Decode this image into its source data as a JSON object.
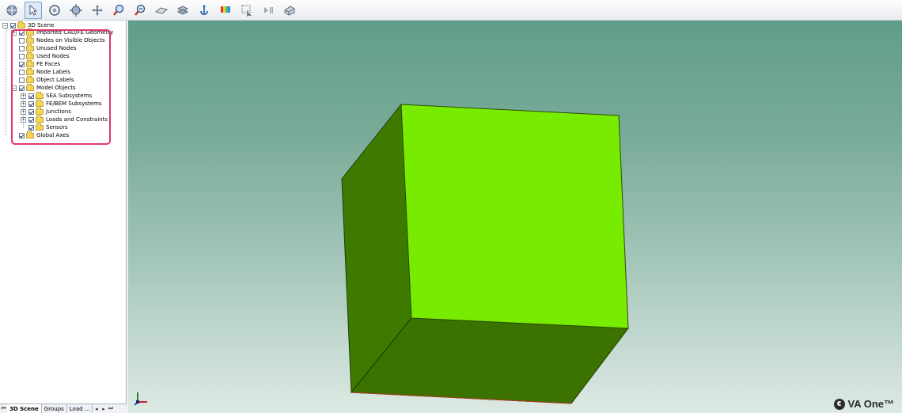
{
  "toolbar": {
    "buttons": [
      "rotate-icon",
      "select-pointer-icon",
      "orbit-icon",
      "target-rotate-icon",
      "pan-icon",
      "zoom-in-icon",
      "zoom-out-icon",
      "plane-view-icon",
      "layers-icon",
      "anchor-icon",
      "color-map-icon",
      "select-region-icon",
      "play-icon",
      "view-cube-icon"
    ]
  },
  "tree": {
    "root": "3D Scene",
    "items": [
      {
        "label": "Imported CAD/FE Geometry",
        "checked": true
      },
      {
        "label": "Nodes on Visible Objects",
        "checked": false
      },
      {
        "label": "Unused Nodes",
        "checked": false
      },
      {
        "label": "Used Nodes",
        "checked": false
      },
      {
        "label": "FE Faces",
        "checked": true
      },
      {
        "label": "Node Labels",
        "checked": false
      },
      {
        "label": "Object Labels",
        "checked": false
      },
      {
        "label": "Model Objects",
        "checked": true
      }
    ],
    "model_children": [
      {
        "label": "SEA Subsystems",
        "checked": true
      },
      {
        "label": "FE/BEM Subsystems",
        "checked": true
      },
      {
        "label": "Junctions",
        "checked": true
      },
      {
        "label": "Loads and Constraints",
        "checked": true
      },
      {
        "label": "Sensors",
        "checked": true
      }
    ],
    "last": {
      "label": "Global Axes",
      "checked": true
    }
  },
  "tabs": {
    "scene": "3D Scene",
    "groups": "Groups",
    "load": "Load ..."
  },
  "viewport": {
    "cube_colors": {
      "front": "#78ec00",
      "side": "#3e7a00",
      "bottom": "#3b7200"
    },
    "logo_text": "VA One™"
  }
}
